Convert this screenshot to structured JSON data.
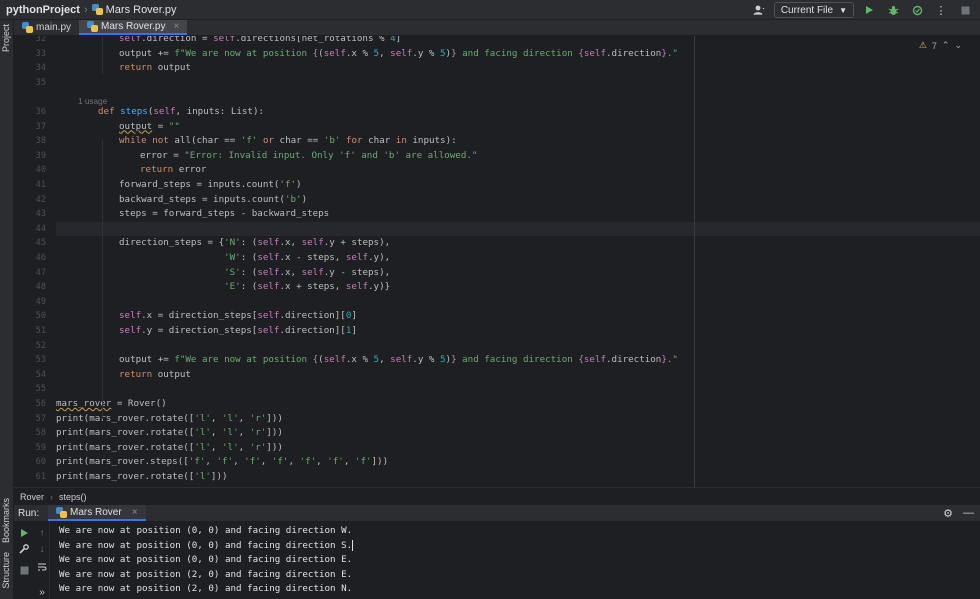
{
  "nav": {
    "project": "pythonProject",
    "file": "Mars Rover.py"
  },
  "toolbar": {
    "run_config": "Current File"
  },
  "tabs": [
    {
      "label": "main.py"
    },
    {
      "label": "Mars Rover.py"
    }
  ],
  "left_strip": {
    "project": "Project",
    "bookmarks": "Bookmarks",
    "structure": "Structure"
  },
  "inspection": {
    "count": "7"
  },
  "editor": {
    "usage_hint": "1 usage",
    "lines": [
      {
        "num": "32",
        "indent": 3,
        "text": "self.direction = self.directions[net_rotations % 4]"
      },
      {
        "num": "33",
        "indent": 3,
        "text": "output += f\"We are now at position {(self.x % 5, self.y % 5)} and facing direction {self.direction}.\""
      },
      {
        "num": "34",
        "indent": 3,
        "text": "return output"
      },
      {
        "num": "35",
        "indent": 0,
        "text": ""
      },
      {
        "num": "36",
        "indent": 2,
        "text": "def steps(self, inputs: List):"
      },
      {
        "num": "37",
        "indent": 3,
        "text": "output = \"\""
      },
      {
        "num": "38",
        "indent": 3,
        "text": "while not all(char == 'f' or char == 'b' for char in inputs):"
      },
      {
        "num": "39",
        "indent": 4,
        "text": "error = \"Error: Invalid input. Only 'f' and 'b' are allowed.\""
      },
      {
        "num": "40",
        "indent": 4,
        "text": "return error"
      },
      {
        "num": "41",
        "indent": 3,
        "text": "forward_steps = inputs.count('f')"
      },
      {
        "num": "42",
        "indent": 3,
        "text": "backward_steps = inputs.count('b')"
      },
      {
        "num": "43",
        "indent": 3,
        "text": "steps = forward_steps - backward_steps"
      },
      {
        "num": "44",
        "indent": 0,
        "text": ""
      },
      {
        "num": "45",
        "indent": 3,
        "text": "direction_steps = {'N': (self.x, self.y + steps),"
      },
      {
        "num": "46",
        "indent": 3,
        "text": "                   'W': (self.x - steps, self.y),"
      },
      {
        "num": "47",
        "indent": 3,
        "text": "                   'S': (self.x, self.y - steps),"
      },
      {
        "num": "48",
        "indent": 3,
        "text": "                   'E': (self.x + steps, self.y)}"
      },
      {
        "num": "49",
        "indent": 0,
        "text": ""
      },
      {
        "num": "50",
        "indent": 3,
        "text": "self.x = direction_steps[self.direction][0]"
      },
      {
        "num": "51",
        "indent": 3,
        "text": "self.y = direction_steps[self.direction][1]"
      },
      {
        "num": "52",
        "indent": 0,
        "text": ""
      },
      {
        "num": "53",
        "indent": 3,
        "text": "output += f\"We are now at position {(self.x % 5, self.y % 5)} and facing direction {self.direction}.\""
      },
      {
        "num": "54",
        "indent": 3,
        "text": "return output"
      },
      {
        "num": "55",
        "indent": 0,
        "text": ""
      },
      {
        "num": "56",
        "indent": 0,
        "text": "mars_rover = Rover()"
      },
      {
        "num": "57",
        "indent": 0,
        "text": "print(mars_rover.rotate(['l', 'l', 'r']))"
      },
      {
        "num": "58",
        "indent": 0,
        "text": "print(mars_rover.rotate(['l', 'l', 'r']))"
      },
      {
        "num": "59",
        "indent": 0,
        "text": "print(mars_rover.rotate(['l', 'l', 'r']))"
      },
      {
        "num": "60",
        "indent": 0,
        "text": "print(mars_rover.steps(['f', 'f', 'f', 'f', 'f', 'f', 'f']))"
      },
      {
        "num": "61",
        "indent": 0,
        "text": "print(mars_rover.rotate(['l']))"
      }
    ]
  },
  "code_breadcrumb": {
    "cls": "Rover",
    "method": "steps()"
  },
  "run": {
    "label": "Run:",
    "tab": "Mars Rover"
  },
  "console": {
    "lines": [
      "We are now at position (0, 0) and facing direction W.",
      "We are now at position (0, 0) and facing direction S.",
      "We are now at position (0, 0) and facing direction E.",
      "We are now at position (2, 0) and facing direction E.",
      "We are now at position (2, 0) and facing direction N."
    ]
  },
  "colors": {
    "background": "#1e1f22",
    "panel": "#2b2d30",
    "keyword": "#cf8e6d",
    "string": "#6aab73",
    "self": "#c77dbb",
    "function": "#56a8f5",
    "number": "#2aacb8",
    "accent": "#3574f0",
    "run_green": "#5fb865"
  }
}
